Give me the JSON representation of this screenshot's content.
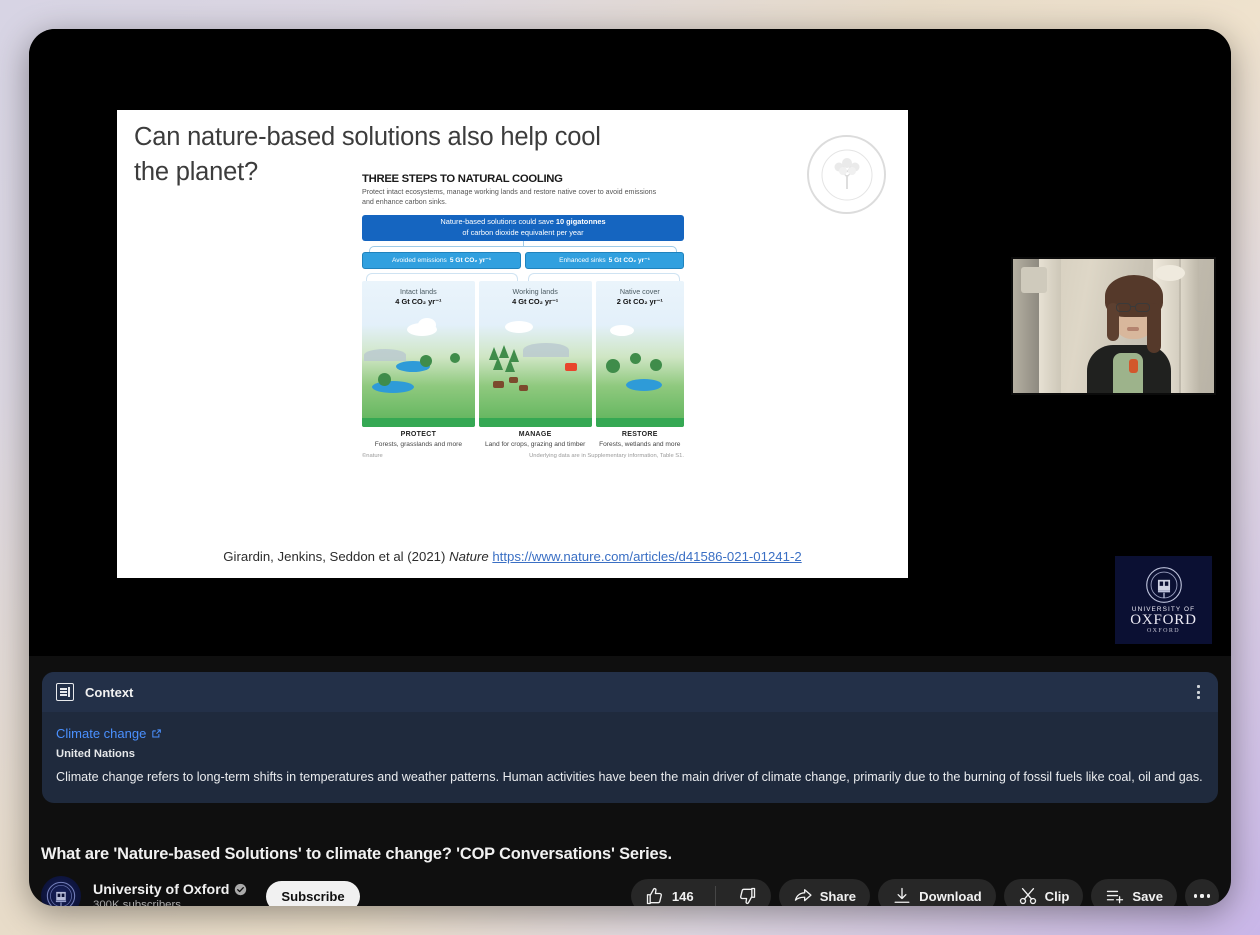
{
  "player": {
    "slide": {
      "title": "Can nature-based solutions also help cool the planet?",
      "watermark_icon": "tree-circle-icon",
      "citation": {
        "authors": "Girardin, Jenkins, Seddon et al (2021)",
        "journal": "Nature",
        "url": "https://www.nature.com/articles/d41586-021-01241-2"
      },
      "infographic": {
        "heading": "THREE STEPS TO NATURAL COOLING",
        "subheading": "Protect intact ecosystems, manage working lands and restore native cover to avoid emissions and enhance carbon sinks.",
        "headline_bar_line1_pre": "Nature-based solutions could save ",
        "headline_bar_line1_bold": "10 gigatonnes",
        "headline_bar_line2": "of carbon dioxide equivalent per year",
        "pills": [
          {
            "label": "Avoided emissions",
            "value": "5 Gt CO₂ yr⁻¹"
          },
          {
            "label": "Enhanced sinks",
            "value": "5 Gt CO₂ yr⁻¹"
          }
        ],
        "panels": [
          {
            "title": "Intact lands",
            "value": "4 Gt CO₂ yr⁻¹",
            "action": "PROTECT",
            "detail": "Forests, grasslands and more"
          },
          {
            "title": "Working lands",
            "value": "4 Gt CO₂ yr⁻¹",
            "action": "MANAGE",
            "detail": "Land for crops, grazing and timber"
          },
          {
            "title": "Native cover",
            "value": "2 Gt CO₂ yr⁻¹",
            "action": "RESTORE",
            "detail": "Forests, wetlands and more"
          }
        ],
        "credit": "©nature",
        "note": "Underlying data are in Supplementary information, Table S1."
      }
    },
    "webcam_inset": {
      "label": "presenter-webcam"
    },
    "branding_overlay": {
      "line1": "UNIVERSITY OF",
      "line2": "OXFORD",
      "line3": "OXFORD",
      "background_color": "#0b1033"
    }
  },
  "context_card": {
    "icon": "context-panel-icon",
    "title": "Context",
    "link_text": "Climate change",
    "link_icon": "external-link-icon",
    "source": "United Nations",
    "description": "Climate change refers to long-term shifts in temperatures and weather patterns. Human activities have been the main driver of climate change, primarily due to the burning of fossil fuels like coal, oil and gas.",
    "menu_icon": "kebab-menu-icon",
    "link_color": "#4a90ff",
    "background_color": "#1f2a3d"
  },
  "video": {
    "title": "What are 'Nature-based Solutions' to climate change? 'COP Conversations' Series.",
    "channel": {
      "name": "University of Oxford",
      "verified": true,
      "subscribers": "300K subscribers",
      "avatar_icon": "oxford-crest-icon"
    },
    "subscribe_label": "Subscribe",
    "actions": {
      "like": {
        "icon": "thumbs-up-icon",
        "count": "146"
      },
      "dislike": {
        "icon": "thumbs-down-icon"
      },
      "share": {
        "icon": "share-arrow-icon",
        "label": "Share"
      },
      "download": {
        "icon": "download-arrow-icon",
        "label": "Download"
      },
      "clip": {
        "icon": "scissors-icon",
        "label": "Clip"
      },
      "save": {
        "icon": "save-list-icon",
        "label": "Save"
      },
      "more": {
        "icon": "more-horizontal-icon"
      }
    }
  }
}
